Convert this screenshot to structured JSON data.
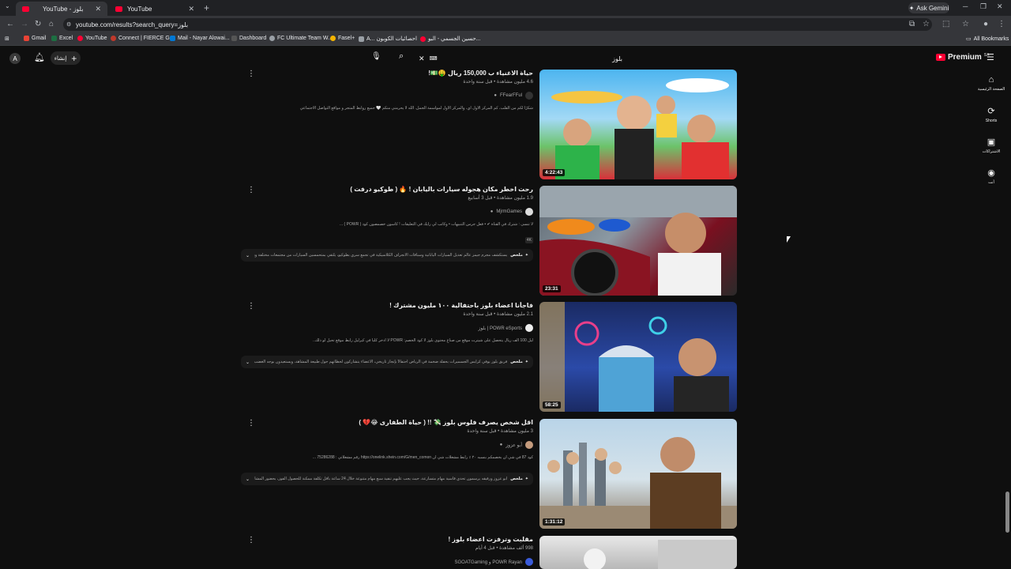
{
  "browser": {
    "tabs": [
      {
        "title": "YouTube - بلوز",
        "active": true
      },
      {
        "title": "YouTube",
        "active": false
      }
    ],
    "gemini_label": "Ask Gemini",
    "url": "youtube.com/results?search_query=بلوز",
    "bookmarks": [
      "Gmail",
      "Excel",
      "YouTube",
      "Connect | FIERCE G...",
      "Mail - Nayar Alowai...",
      "Dashboard",
      "FC Ultimate Team W...",
      "Fasel+",
      "A... احصائيات الكوبون",
      "حسين الجسمي - البو..."
    ],
    "all_bookmarks": "All Bookmarks"
  },
  "yt": {
    "avatar_letter": "A",
    "create_label": "إنشاء",
    "search_query": "بلوز",
    "logo": "Premium",
    "country": "SA",
    "nav": [
      {
        "label": "الصفحة الرئيسية",
        "icon": "⌂"
      },
      {
        "label": "Shorts",
        "icon": "⟳"
      },
      {
        "label": "الاشتراكات",
        "icon": "▣"
      },
      {
        "label": "أنت",
        "icon": "◉"
      }
    ]
  },
  "results": [
    {
      "title": "حياة الاغنياء ب 150,000 ريال 🤑💵!",
      "meta": "4.6 مليون مشاهدة • قبل سنة واحدة",
      "channel": "FFearFFul",
      "desc": "شكرًا لكم من القلب، كم المركز الأول أي، والمركز الأول لمواسمة الجمل. الله لا يحرمني منكم 🤍 جميع روابط المتجر و مواقع التواصل الاجتماعي",
      "duration": "4:22:43",
      "badge": "",
      "summary": ""
    },
    {
      "title": "رحت اخطر مكان هجوله سيارات باليابان ! 🔥 ( طوكيو درفت )",
      "meta": "1.9 مليون مشاهدة • قبل 3 أسابيع",
      "channel": "MjrmGames",
      "desc": "لا تنسى : شترك في القناة ✔ • فعل جرس التنبيهات • وكاتب لي رأيك في التعليقات ! كاسون خصمصون كود ( POWR ) ...",
      "duration": "23:31",
      "badge": "4K",
      "summary_label": "ملخص",
      "summary": "يستكشف مجرم جيمز عالم تعديل السيارات اليابانية وسباقات الانجراف الكلاسيكية في تجمع سري بطوكيو، يلتقي بمتحمسين السيارات من مجتمعات مختلفة ويشارك..."
    },
    {
      "title": "فاجأنا اعضاء بلوز باحتفالية ١٠٠ مليون مشترك !",
      "meta": "2.1 مليون مشاهدة • قبل سنة واحدة",
      "channel": "POWR eSports | بلوز",
      "desc": "ليل 100 الف ريال يتحصل على شيترت موقع من صناع محتوى بلوز لا كود الخصم: POWR لا ادخر كلياً في كيرليل رابط موقع تحيل لو ذلك..",
      "duration": "58:25",
      "badge": "",
      "summary_label": "ملخص",
      "summary": "فريق بلوز يوفي كرايس الجسميرات بحفلة ضخمة في الرياض احتفالاً بإنجاز تاريخي، الأعضاء يتشاركون لحظاتهم حول طبيعة المشاهد، ويستعيدون بوجه الغضب..."
    },
    {
      "title": "اقل شخص يصرف فلوس بلوز 💸 !! ( حياة الطفارى 😂💔 )",
      "meta": "3 مليون مشاهدة • قبل سنة واحدة",
      "channel": "أبو عزوز",
      "desc": "كود 87 في شي ان بخصمكم بنسبه ٢٠ ٪ رابط مشغلات شي ان https://onelink.shein.com/G/men_comon رقم مشغلاتي : 75286288 ...",
      "duration": "1:31:12",
      "badge": "",
      "summary_label": "ملخص",
      "summary": "أبو عزوز ورفيقه يرسمون تحدي قاسية مهام متسارعة، حيث يجب عليهم تنفيذ سبع مهام متنوعة خلال 24 ساعة بأقل تكلفة ممكنة للحصول الفوز، بحضور المشاركين مبيه..."
    },
    {
      "title": "مقلبت وترفزت اعضاء بلوز !",
      "meta": "998 ألف مشاهدة • قبل 4 أيام",
      "channel": "POWR Rayan و SGOATGaming",
      "desc": "",
      "duration": "",
      "badge": "",
      "summary": ""
    }
  ]
}
